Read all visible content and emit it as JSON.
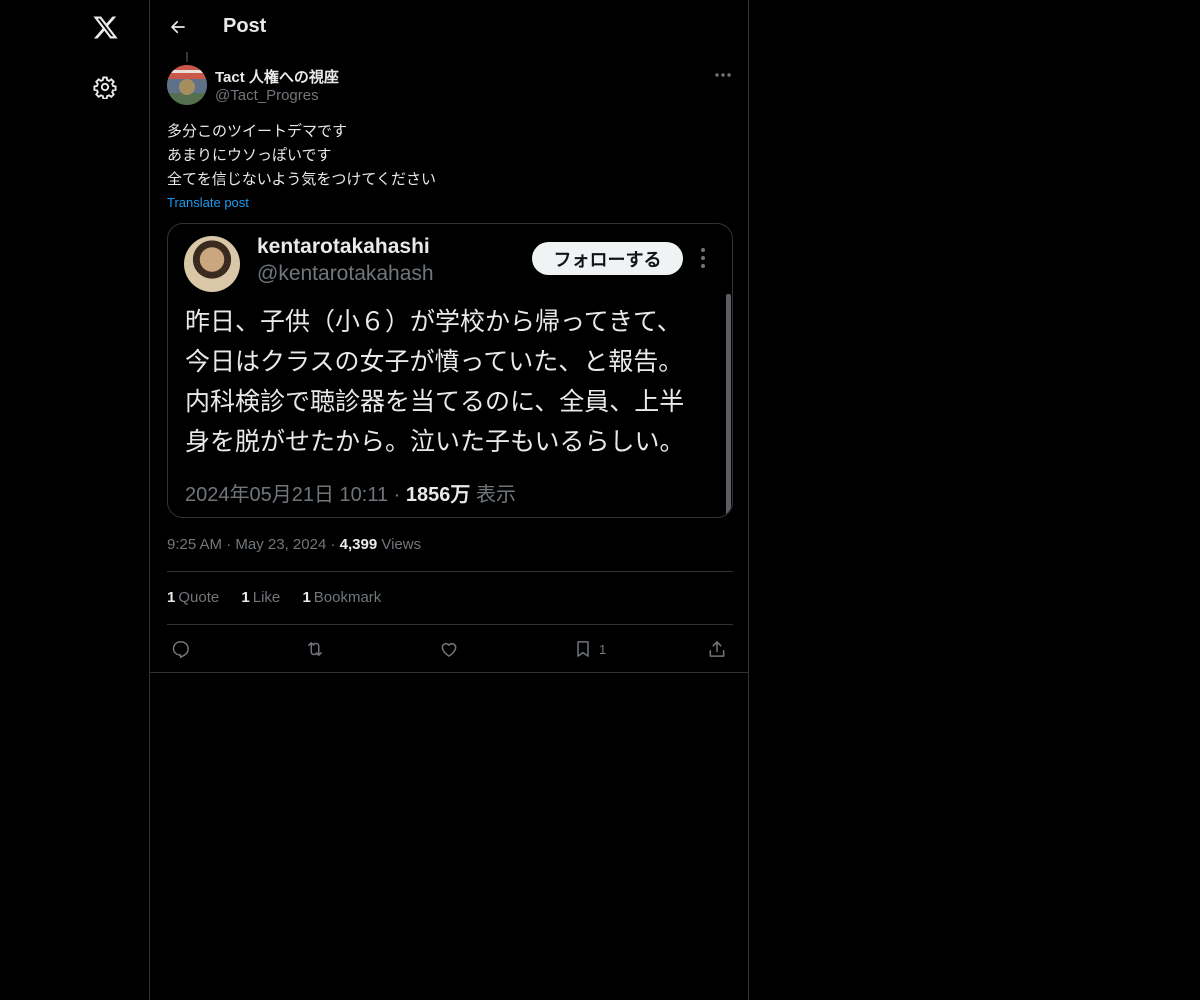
{
  "nav": {
    "logo_icon": "x-logo-icon",
    "settings_icon": "gear-icon"
  },
  "header": {
    "title": "Post",
    "back_icon": "arrow-left-icon"
  },
  "post": {
    "author_name": "Tact 人権への視座",
    "author_handle": "@Tact_Progres",
    "text_lines": [
      "多分このツイートデマです",
      "あまりにウソっぽいです",
      "全てを信じないよう気をつけてください"
    ],
    "translate_label": "Translate post",
    "time": "9:25 AM",
    "date": "May 23, 2024",
    "views_count": "4,399",
    "views_label": "Views",
    "sep": "·"
  },
  "embed": {
    "name": "kentarotakahashi",
    "handle": "@kentarotakahash",
    "follow_label": "フォローする",
    "body_lines": [
      "昨日、子供（小６）が学校から帰ってきて、",
      "今日はクラスの女子が憤っていた、と報告。",
      "内科検診で聴診器を当てるのに、全員、上半",
      "身を脱がせたから。泣いた子もいるらしい。"
    ],
    "meta_date": "2024年05月21日 10:11 ·",
    "meta_views": "1856万",
    "meta_views_label": "表示"
  },
  "stats": {
    "quotes_count": "1",
    "quotes_label": "Quote",
    "likes_count": "1",
    "likes_label": "Like",
    "bookmarks_count": "1",
    "bookmarks_label": "Bookmark"
  },
  "actions": {
    "reply_icon": "reply-icon",
    "repost_icon": "repost-icon",
    "like_icon": "heart-icon",
    "bookmark_icon": "bookmark-icon",
    "bookmark_count": "1",
    "share_icon": "share-icon"
  },
  "colors": {
    "background": "#000000",
    "text_primary": "#e7e9ea",
    "text_secondary": "#71767b",
    "link": "#1d9bf0",
    "border": "#2f3336"
  }
}
